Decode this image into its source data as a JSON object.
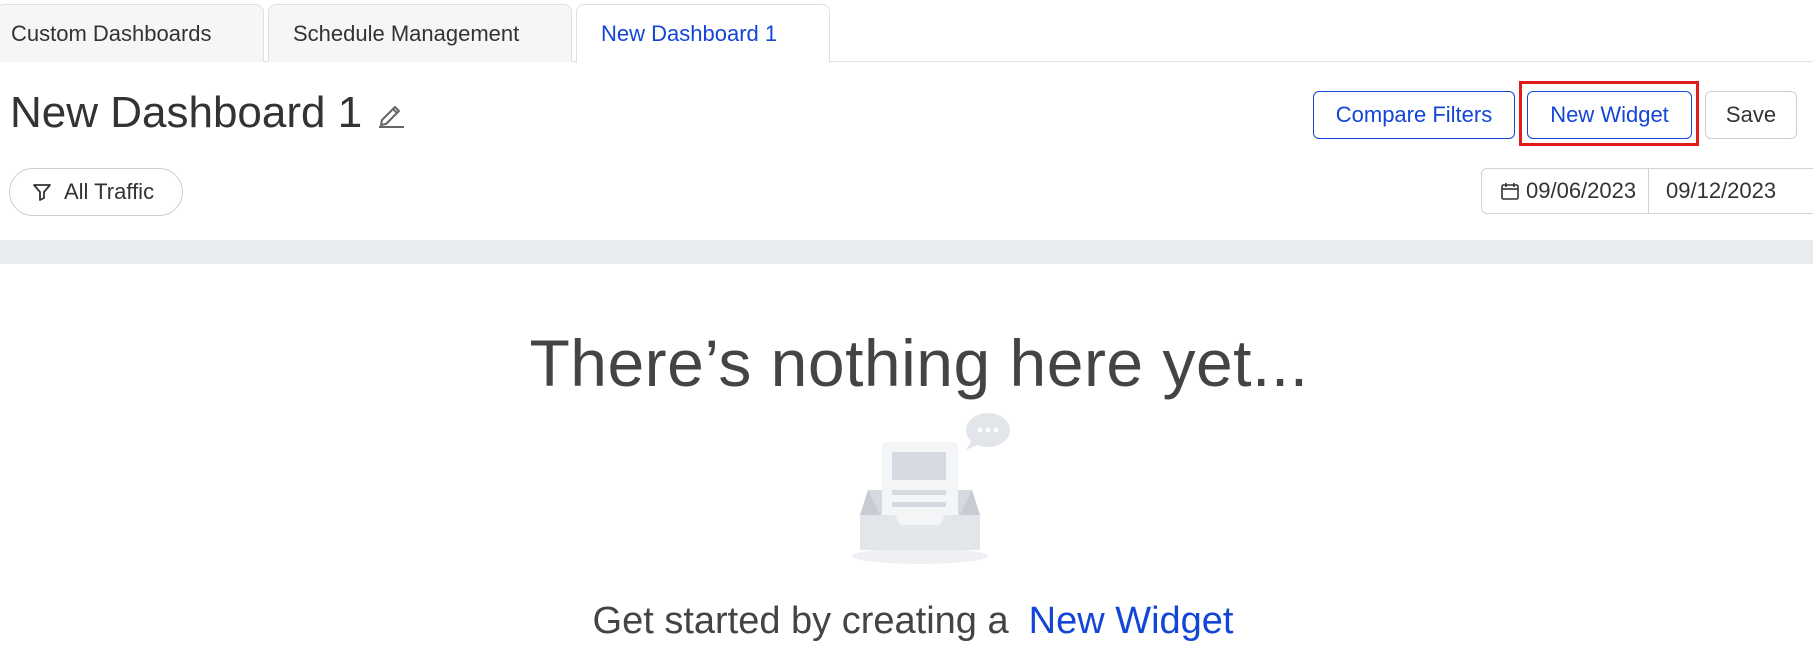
{
  "tabs": [
    {
      "label": "Custom Dashboards",
      "active": false
    },
    {
      "label": "Schedule Management",
      "active": false
    },
    {
      "label": "New Dashboard 1",
      "active": true
    }
  ],
  "header": {
    "title": "New Dashboard 1",
    "edit_icon": "pencil-icon",
    "compare_filters_label": "Compare Filters",
    "new_widget_label": "New Widget",
    "save_label": "Save"
  },
  "filters": {
    "traffic_label": "All Traffic",
    "filter_icon": "funnel-icon",
    "date_icon": "calendar-icon",
    "start_date": "09/06/2023",
    "end_date": "09/12/2023"
  },
  "empty_state": {
    "heading": "There’s nothing here yet...",
    "cta_text": "Get started by creating a",
    "cta_link": "New Widget",
    "illustration": "empty-inbox-illustration"
  },
  "colors": {
    "accent": "#1346d6",
    "highlight": "#e01b1b",
    "band": "#e9ecef"
  }
}
